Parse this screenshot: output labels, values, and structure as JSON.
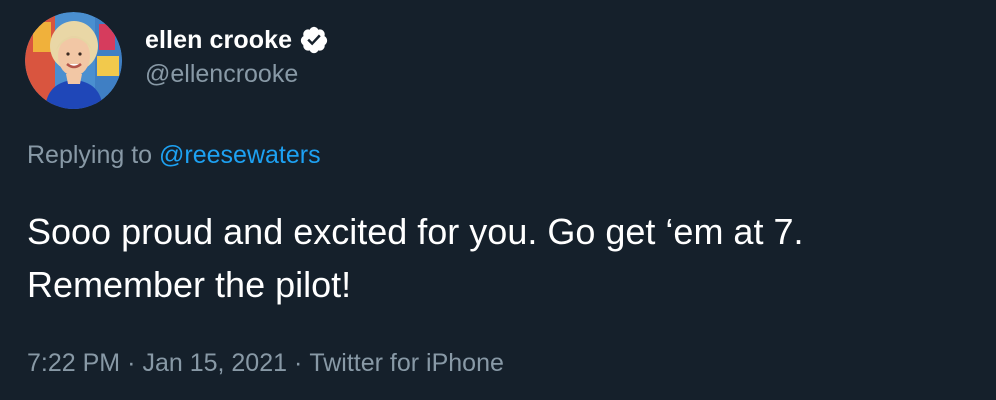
{
  "author": {
    "display_name": "ellen crooke",
    "handle": "@ellencrooke",
    "verified": true,
    "avatar_icon": "profile-photo-icon",
    "verified_icon": "verified-badge-icon"
  },
  "reply": {
    "prefix": "Replying to",
    "mention": "@reesewaters"
  },
  "tweet": {
    "text": "Sooo proud and excited for you.  Go get ‘em at 7.\nRemember the pilot!"
  },
  "meta": {
    "time": "7:22 PM",
    "separator": "·",
    "date": "Jan 15, 2021",
    "source": "Twitter for iPhone"
  },
  "colors": {
    "background": "#15202b",
    "primary_text": "#ffffff",
    "secondary_text": "#8899a6",
    "link": "#1da1f2"
  }
}
